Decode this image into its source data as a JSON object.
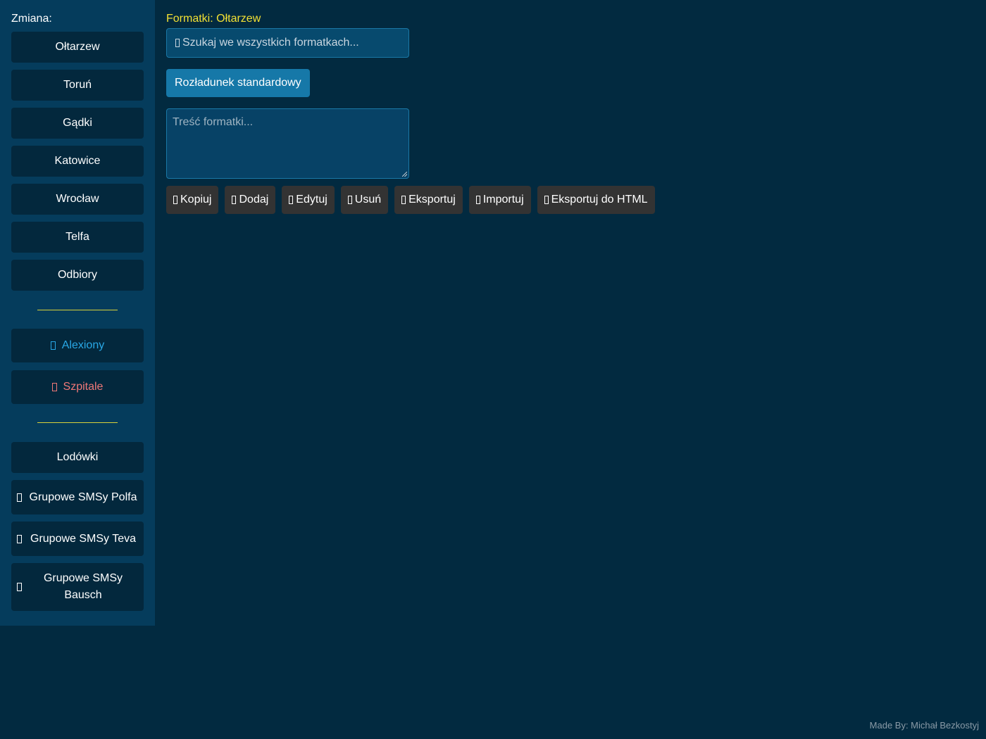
{
  "sidebar": {
    "title": "Zmiana:",
    "locations": [
      "Ołtarzew",
      "Toruń",
      "Gądki",
      "Katowice",
      "Wrocław",
      "Telfa",
      "Odbiory"
    ],
    "special": {
      "alexiony": "Alexiony",
      "szpitale": "Szpitale"
    },
    "extra": {
      "lodowki": "Lodówki",
      "sms_polfa": "Grupowe SMSy Polfa",
      "sms_teva": "Grupowe SMSy Teva",
      "sms_bausch": "Grupowe SMSy Bausch"
    },
    "colors": {
      "alexiony": "#29a8e6",
      "szpitale": "#f07878",
      "divider": "#d9d23a"
    }
  },
  "main": {
    "title": "Formatki: Ołtarzew",
    "search_placeholder": "Szukaj we wszystkich formatkach...",
    "template_button": "Rozładunek standardowy",
    "textarea_placeholder": "Treść formatki...",
    "actions": {
      "copy": "Kopiuj",
      "add": "Dodaj",
      "edit": "Edytuj",
      "delete": "Usuń",
      "export": "Eksportuj",
      "import": "Importuj",
      "export_html": "Eksportuj do HTML"
    }
  },
  "footer": {
    "credit": "Made By: Michał Bezkostyj"
  }
}
